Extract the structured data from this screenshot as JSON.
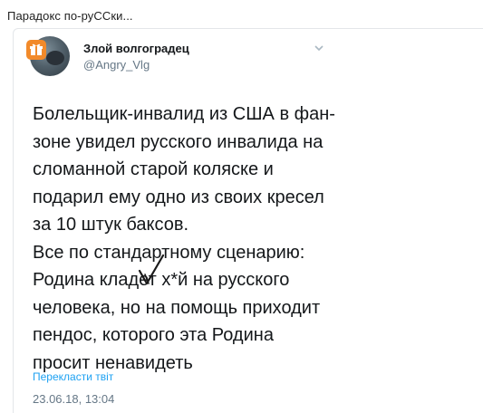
{
  "caption": "Парадокс по-руССки...",
  "tweet": {
    "author_name": "Злой волгоградец",
    "author_handle": "@Angry_Vlg",
    "text_lines": [
      "Болельщик-инвалид из США в фан-",
      "зоне увидел русского инвалида на",
      "сломанной старой коляске и",
      "подарил ему одно из своих кресел",
      "за 10 штук баксов.",
      "Все по стандартному сценарию:",
      "Родина кладет х*й на русского",
      "человека, но на помощь приходит",
      "пендос, которого эта Родина",
      "просит ненавидеть"
    ],
    "translate_label": "Перекласти твіт",
    "timestamp": "23.06.18, 13:04"
  },
  "colors": {
    "link": "#1da1f2",
    "muted": "#657786",
    "text": "#14171a",
    "badge": "#f28a2a"
  },
  "icons": {
    "avatar_badge": "gift-icon",
    "menu": "chevron-down-icon"
  }
}
